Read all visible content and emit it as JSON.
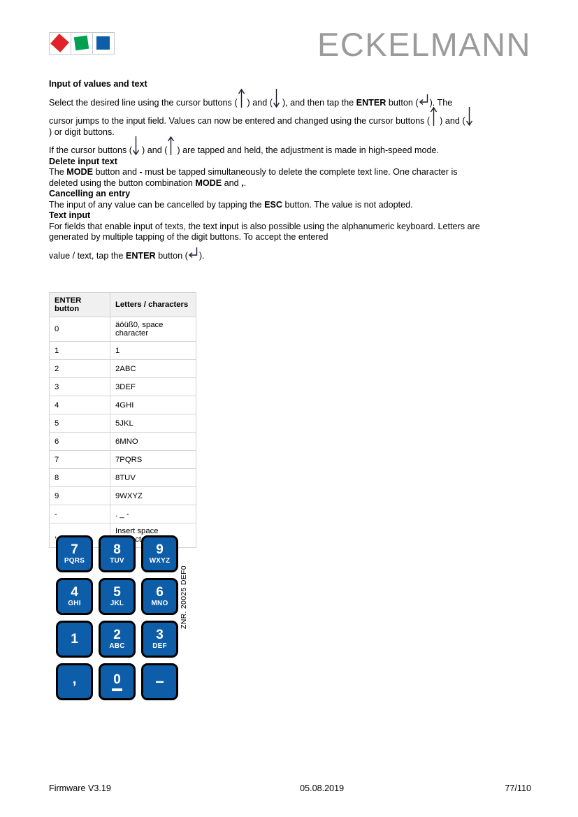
{
  "header": {
    "brand": "ECKELMANN",
    "logo_marks": [
      "red-diamond",
      "green-square",
      "blue-square"
    ],
    "colors": {
      "red": "#e1222b",
      "green": "#00a050",
      "blue": "#0d5da8",
      "brand_gray": "#9b9b9b"
    }
  },
  "content": {
    "section1_title": "Input of values and text",
    "p1_a": "Select the desired line using the cursor buttons (",
    "p1_b": ") and (",
    "p1_c": "), and then tap the ",
    "p1_enter": "ENTER",
    "p1_d": " button (",
    "p1_e": "). The",
    "p2_a": "cursor jumps to the input field. Values can now be entered and changed using the cursor buttons (",
    "p2_b": ") and (",
    "p2_c": ") or digit buttons.",
    "p3_a": "If the cursor buttons (",
    "p3_b": ") and (",
    "p3_c": ") are tapped and held, the adjustment is made in high-speed mode.",
    "section2_title": "Delete input text",
    "p4_a": "The ",
    "p4_mode": "MODE",
    "p4_b": " button and ",
    "p4_minus": "-",
    "p4_c": " must be tapped simultaneously to delete the complete text line. One character is",
    "p4_d": "deleted using the button combination ",
    "p4_mode2": "MODE",
    "p4_e": " and ",
    "p4_comma": ",",
    "p4_f": ".",
    "section3_title": "Cancelling an entry",
    "p5_a": "The input of any value can be cancelled by tapping the ",
    "p5_esc": "ESC",
    "p5_b": " button. The value is not adopted.",
    "section4_title": "Text input",
    "p6_a": "For fields that enable input of texts, the text input is also possible using the alphanumeric keyboard. Letters are",
    "p6_b": "generated by multiple tapping of the digit buttons. To accept the entered",
    "p7_a": "value / text, tap the ",
    "p7_enter": "ENTER",
    "p7_b": " button (",
    "p7_c": ")."
  },
  "table": {
    "headers": [
      "ENTER button",
      "Letters / characters"
    ],
    "rows": [
      [
        "0",
        "äöüß0, space character"
      ],
      [
        "1",
        "1"
      ],
      [
        "2",
        "2ABC"
      ],
      [
        "3",
        "3DEF"
      ],
      [
        "4",
        "4GHI"
      ],
      [
        "5",
        "5JKL"
      ],
      [
        "6",
        "6MNO"
      ],
      [
        "7",
        "7PQRS"
      ],
      [
        "8",
        "8TUV"
      ],
      [
        "9",
        "9WXYZ"
      ],
      [
        "-",
        ". _ -"
      ],
      [
        ",",
        "Insert space character"
      ]
    ]
  },
  "keypad": {
    "keys": [
      {
        "digit": "7",
        "letters": "PQRS"
      },
      {
        "digit": "8",
        "letters": "TUV"
      },
      {
        "digit": "9",
        "letters": "WXYZ"
      },
      {
        "digit": "4",
        "letters": "GHI"
      },
      {
        "digit": "5",
        "letters": "JKL"
      },
      {
        "digit": "6",
        "letters": "MNO"
      },
      {
        "digit": "1",
        "letters": ""
      },
      {
        "digit": "2",
        "letters": "ABC"
      },
      {
        "digit": "3",
        "letters": "DEF"
      },
      {
        "digit": ",",
        "letters": ""
      },
      {
        "digit": "0",
        "letters": "space-underbar"
      },
      {
        "digit": "−",
        "letters": ""
      }
    ]
  },
  "side_code": "ZNR. 20025 DEF0",
  "footer": {
    "left": "Firmware V3.19",
    "center": "05.08.2019",
    "right": "77/110"
  }
}
